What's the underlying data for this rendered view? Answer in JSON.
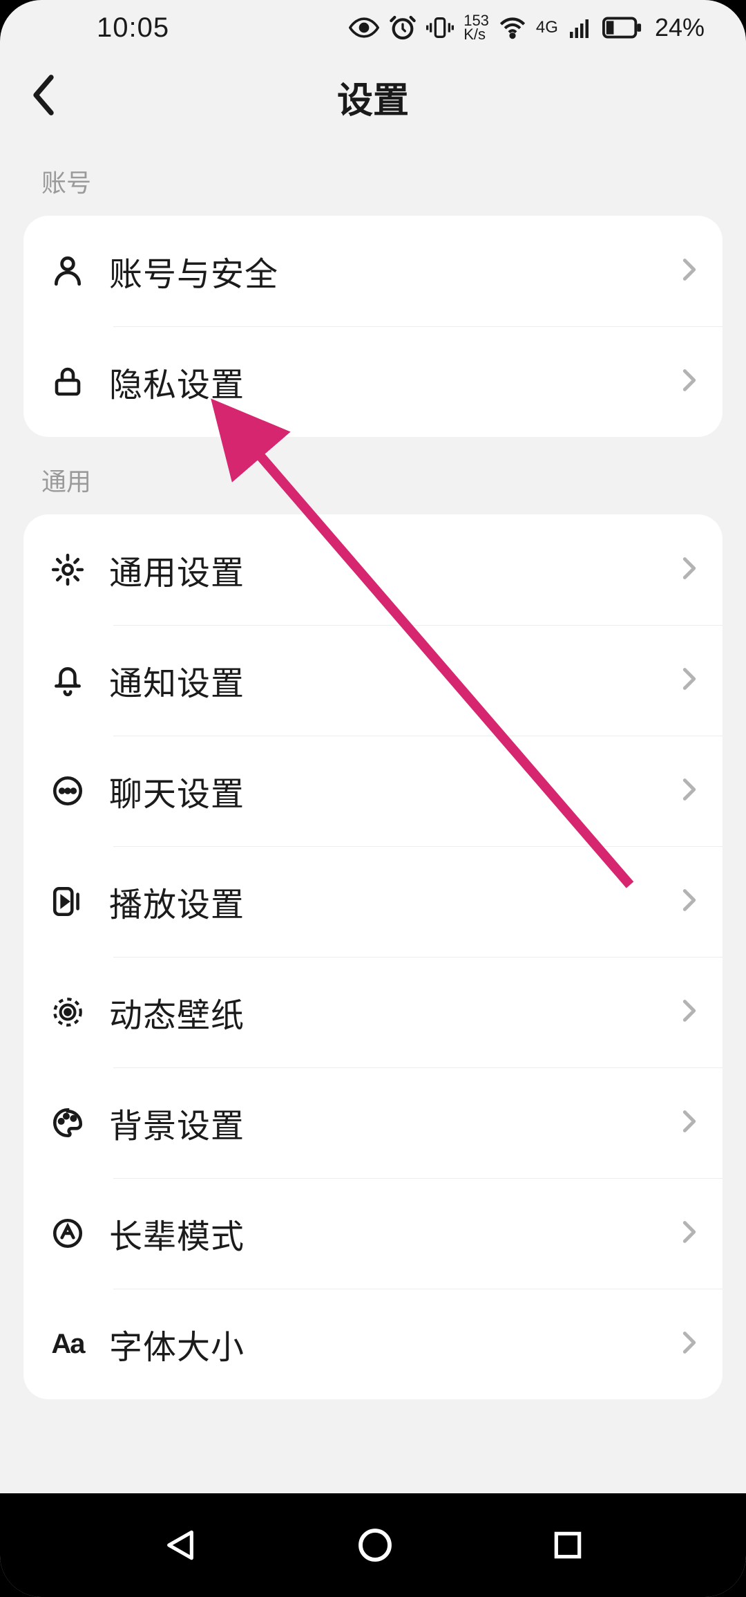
{
  "status": {
    "time": "10:05",
    "speed_top": "153",
    "speed_bottom": "K/s",
    "net_label": "4G",
    "battery_pct": "24%"
  },
  "header": {
    "title": "设置"
  },
  "sections": {
    "account": {
      "label": "账号",
      "items": [
        "账号与安全",
        "隐私设置"
      ]
    },
    "general": {
      "label": "通用",
      "items": [
        "通用设置",
        "通知设置",
        "聊天设置",
        "播放设置",
        "动态壁纸",
        "背景设置",
        "长辈模式",
        "字体大小"
      ]
    }
  },
  "annotation": {
    "arrow_color": "#d6266f"
  }
}
